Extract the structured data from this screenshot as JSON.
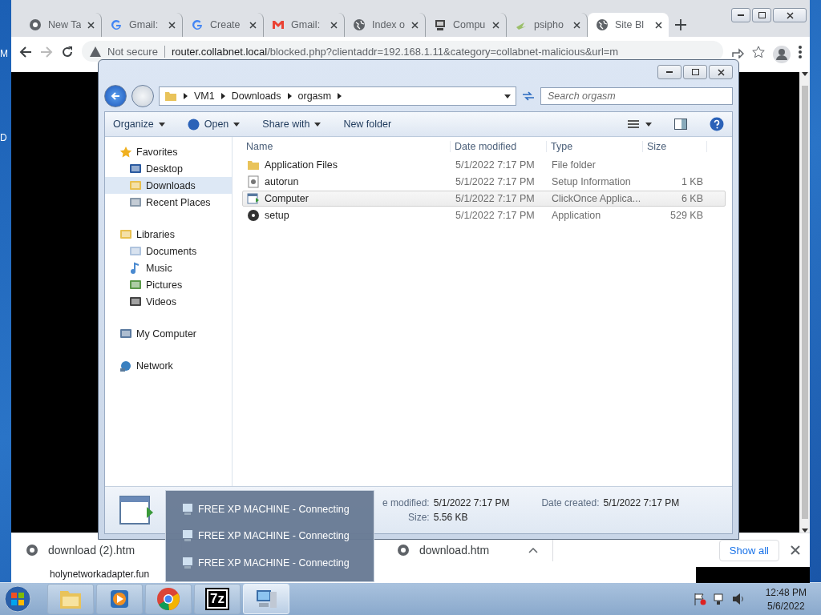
{
  "desktop_labels": [
    "M",
    "D"
  ],
  "browser": {
    "tabs": [
      {
        "label": "New Ta",
        "kind": "chrome",
        "selected": false
      },
      {
        "label": "Gmail:",
        "kind": "google",
        "selected": false
      },
      {
        "label": "Create",
        "kind": "google",
        "selected": false
      },
      {
        "label": "Gmail:",
        "kind": "gmail",
        "selected": false
      },
      {
        "label": "Index o",
        "kind": "globe",
        "selected": false
      },
      {
        "label": "Compu",
        "kind": "computer",
        "selected": false
      },
      {
        "label": "psipho",
        "kind": "psiphon",
        "selected": false
      },
      {
        "label": "Site Bl",
        "kind": "globe",
        "selected": true
      }
    ],
    "address": {
      "security": "Not secure",
      "host": "router.collabnet.local",
      "path": "/blocked.php?clientaddr=192.168.1.11&category=collabnet-malicious&url=m"
    },
    "downloads": [
      "download (2).htm",
      "download.htm"
    ],
    "show_all": "Show all",
    "status_url": "holynetworkadapter.fun"
  },
  "explorer": {
    "breadcrumb": [
      "VM1",
      "Downloads",
      "orgasm"
    ],
    "search_placeholder": "Search orgasm",
    "toolbar": [
      {
        "label": "Organize",
        "kind": "menu"
      },
      {
        "label": "Open",
        "kind": "open"
      },
      {
        "label": "Share with",
        "kind": "menu"
      },
      {
        "label": "New folder",
        "kind": "plain"
      }
    ],
    "nav": [
      {
        "label": "Favorites",
        "kind": "star",
        "selected": false,
        "children": [
          {
            "label": "Desktop",
            "kind": "desktop",
            "selected": false
          },
          {
            "label": "Downloads",
            "kind": "downloads",
            "selected": true
          },
          {
            "label": "Recent Places",
            "kind": "recent",
            "selected": false
          }
        ]
      },
      {
        "label": "Libraries",
        "kind": "libraries",
        "selected": false,
        "children": [
          {
            "label": "Documents",
            "kind": "documents",
            "selected": false
          },
          {
            "label": "Music",
            "kind": "music",
            "selected": false
          },
          {
            "label": "Pictures",
            "kind": "pictures",
            "selected": false
          },
          {
            "label": "Videos",
            "kind": "videos",
            "selected": false
          }
        ]
      },
      {
        "label": "My Computer",
        "kind": "computer",
        "selected": false
      },
      {
        "label": "Network",
        "kind": "network",
        "selected": false
      }
    ],
    "columns": [
      "Name",
      "Date modified",
      "Type",
      "Size"
    ],
    "files": [
      {
        "name": "Application Files",
        "date": "5/1/2022 7:17 PM",
        "type": "File folder",
        "kind": "folder",
        "selected": false
      },
      {
        "name": "autorun",
        "date": "5/1/2022 7:17 PM",
        "type": "Setup Information",
        "size": "1 KB",
        "kind": "setup-info",
        "selected": false
      },
      {
        "name": "Computer",
        "date": "5/1/2022 7:17 PM",
        "type": "ClickOnce Applica...",
        "size": "6 KB",
        "kind": "clickonce",
        "selected": true
      },
      {
        "name": "setup",
        "date": "5/1/2022 7:17 PM",
        "type": "Application",
        "size": "529 KB",
        "kind": "application",
        "selected": false
      }
    ],
    "details": {
      "modified_label": "e modified:",
      "modified": "5/1/2022 7:17 PM",
      "size_label": "Size:",
      "size": "5.56 KB",
      "created_label": "Date created:",
      "created": "5/1/2022 7:17 PM"
    }
  },
  "jump_list": [
    "FREE XP MACHINE - Connecting",
    "FREE XP MACHINE - Connecting",
    "FREE XP MACHINE - Connecting"
  ],
  "taskbar": {
    "apps": [
      {
        "kind": "folder",
        "selected": false
      },
      {
        "kind": "media",
        "selected": false
      },
      {
        "kind": "chrome",
        "selected": false
      },
      {
        "kind": "archiver",
        "label": "7z",
        "selected": false
      },
      {
        "kind": "computer",
        "selected": true
      }
    ],
    "time": "12:48 PM",
    "date": "5/6/2022"
  }
}
